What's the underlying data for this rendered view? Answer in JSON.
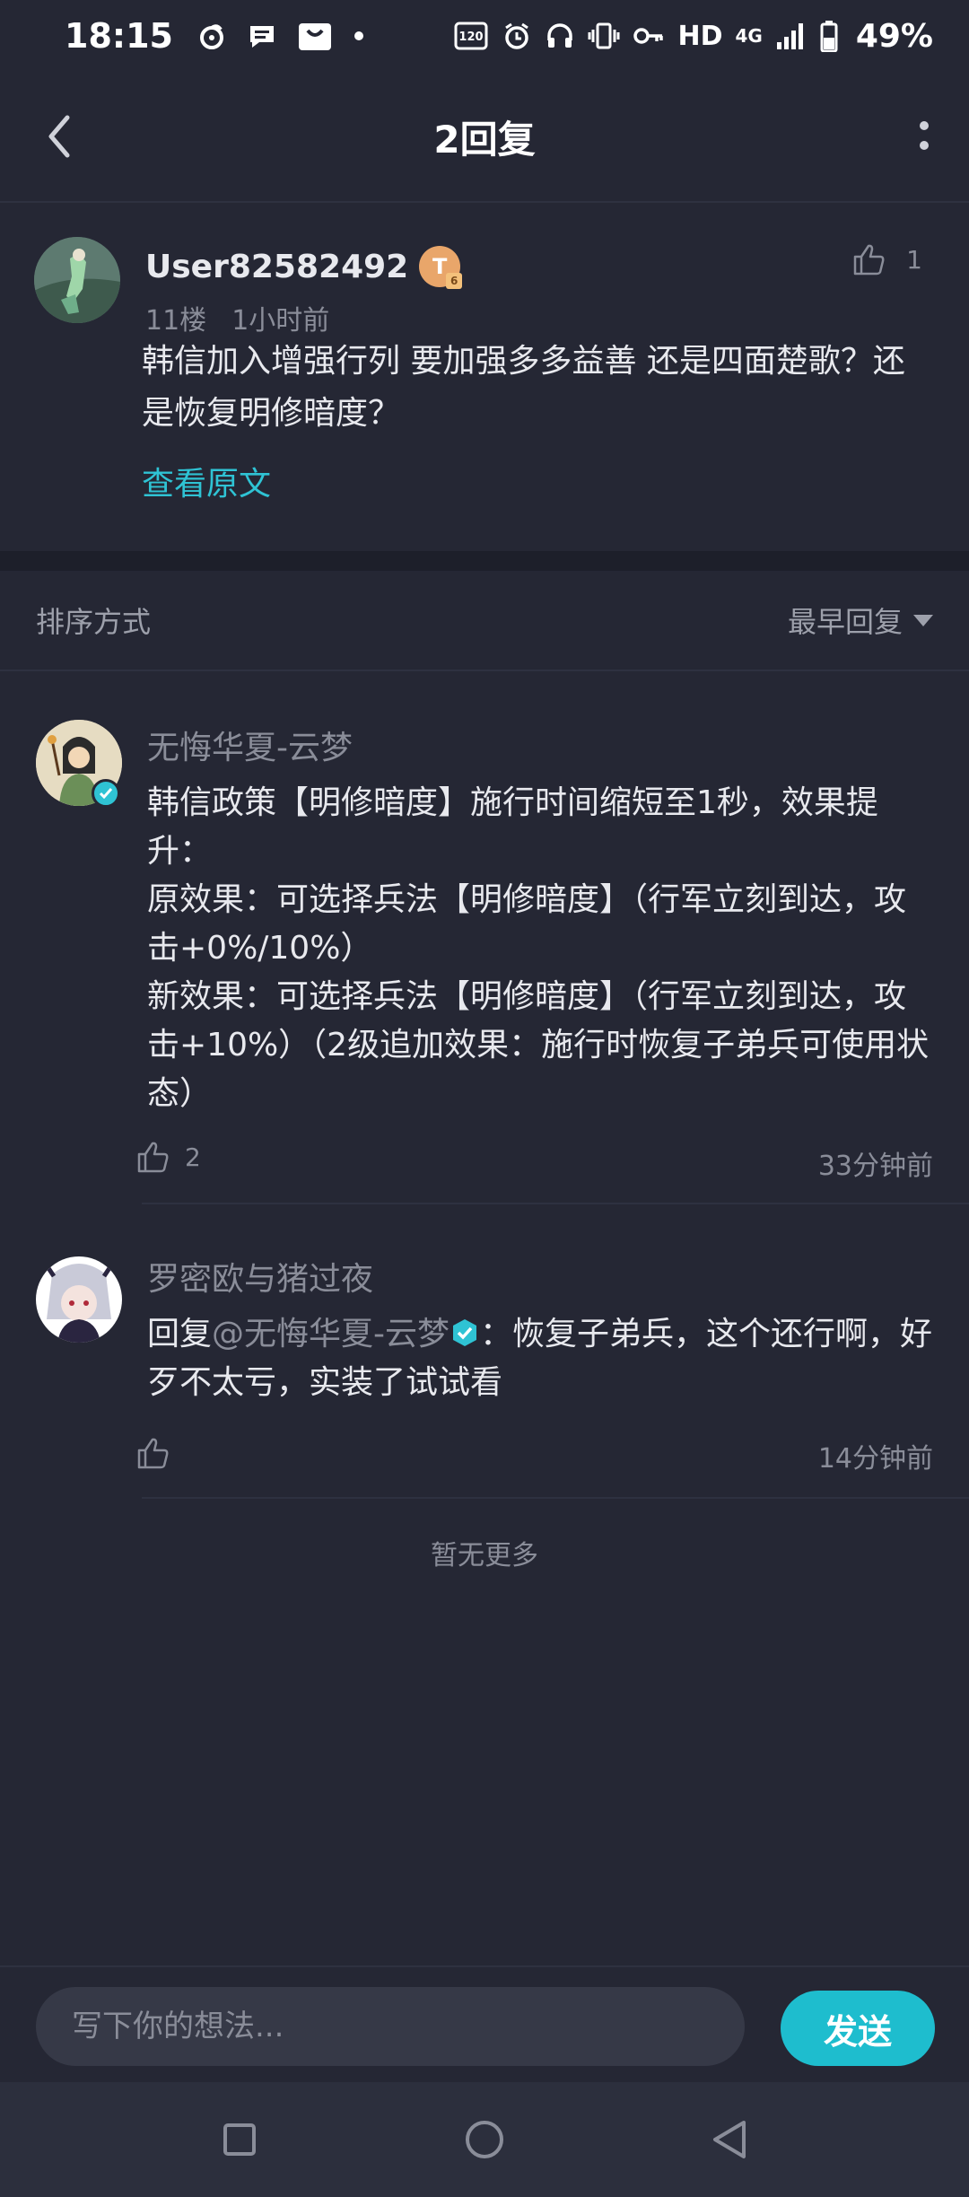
{
  "status_bar": {
    "time": "18:15",
    "network": "HD",
    "signal_type": "4G",
    "battery": "49%",
    "refresh_rate": "120",
    "icons": [
      "weibo-icon",
      "message-icon",
      "shop-icon",
      "dot-icon",
      "refresh-rate-icon",
      "alarm-icon",
      "headphones-icon",
      "vibrate-icon",
      "key-icon",
      "signal-icon",
      "battery-icon"
    ]
  },
  "header": {
    "title": "2回复"
  },
  "post": {
    "username": "User82582492",
    "level_badge": "T",
    "floor": "11楼",
    "time": "1小时前",
    "like_count": "1",
    "text": "韩信加入增强行列 要加强多多益善 还是四面楚歌？还是恢复明修暗度？",
    "view_original": "查看原文"
  },
  "sort": {
    "label": "排序方式",
    "selected": "最早回复"
  },
  "replies": [
    {
      "username": "无悔华夏-云梦",
      "text": "韩信政策【明修暗度】施行时间缩短至1秒，效果提升：\n原效果：可选择兵法【明修暗度】（行军立刻到达，攻击+0%/10%）\n新效果：可选择兵法【明修暗度】（行军立刻到达，攻击+10%）（2级追加效果：施行时恢复子弟兵可使用状态）",
      "like_count": "2",
      "time": "33分钟前"
    },
    {
      "username": "罗密欧与猪过夜",
      "reply_prefix": "回复",
      "mention": "@无悔华夏-云梦",
      "text_after_mention": "：恢复子弟兵，这个还行啊，好歹不太亏，实装了试试看",
      "like_count": "",
      "time": "14分钟前"
    }
  ],
  "no_more": "暂无更多",
  "input": {
    "placeholder": "写下你的想法...",
    "send_label": "发送"
  },
  "colors": {
    "background": "#252734",
    "accent": "#1ebdce",
    "link": "#2fc3d4",
    "muted_text": "#8a8d99"
  }
}
